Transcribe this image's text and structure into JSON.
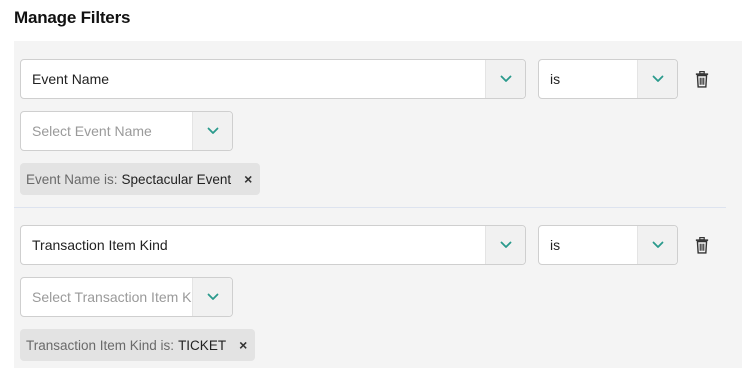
{
  "header": {
    "title": "Manage Filters"
  },
  "filters": [
    {
      "field": "Event Name",
      "operator": "is",
      "value_placeholder": "Select Event Name",
      "chip_key": "Event Name is:",
      "chip_value": "Spectacular Event",
      "chip_remove": "×"
    },
    {
      "field": "Transaction Item Kind",
      "operator": "is",
      "value_placeholder": "Select Transaction Item K",
      "chip_key": "Transaction Item Kind is:",
      "chip_value": "TICKET",
      "chip_remove": "×"
    }
  ],
  "icons": {
    "caret": "chevron-down-icon",
    "delete": "trash-icon"
  },
  "colors": {
    "accent": "#2a9a8c",
    "panel": "#f4f4f4",
    "chip": "#e3e3e3"
  }
}
